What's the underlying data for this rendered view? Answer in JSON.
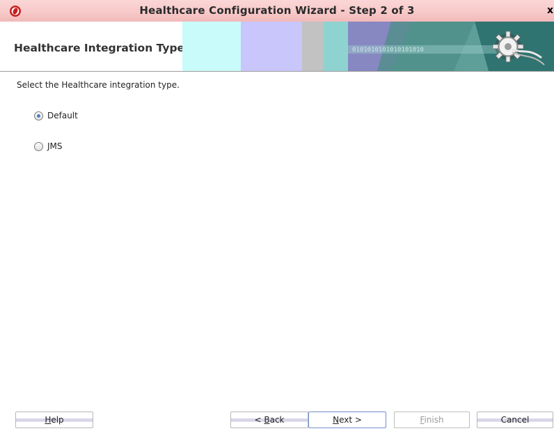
{
  "window": {
    "title": "Healthcare Configuration Wizard - Step 2 of 3",
    "close_glyph": "x"
  },
  "header": {
    "title": "Healthcare Integration Type",
    "banner_text": "0101010101010101010"
  },
  "body": {
    "prompt": "Select the Healthcare integration type.",
    "options": [
      {
        "label": "Default",
        "selected": true
      },
      {
        "label": "JMS",
        "selected": false
      }
    ]
  },
  "buttons": {
    "help": {
      "mnemonic": "H",
      "rest": "elp"
    },
    "back": {
      "prefix": "< ",
      "mnemonic": "B",
      "rest": "ack"
    },
    "next": {
      "mnemonic": "N",
      "rest": "ext >"
    },
    "finish": {
      "mnemonic": "F",
      "rest": "inish",
      "enabled": false
    },
    "cancel": {
      "label": "Cancel"
    }
  },
  "colors": {
    "titlebar": "#f7c8c8",
    "accent_radio": "#4a7fc7",
    "banner_cyan": "#c9fbfb",
    "banner_lavender": "#c8c6fb",
    "banner_teal": "#3f8a86"
  }
}
